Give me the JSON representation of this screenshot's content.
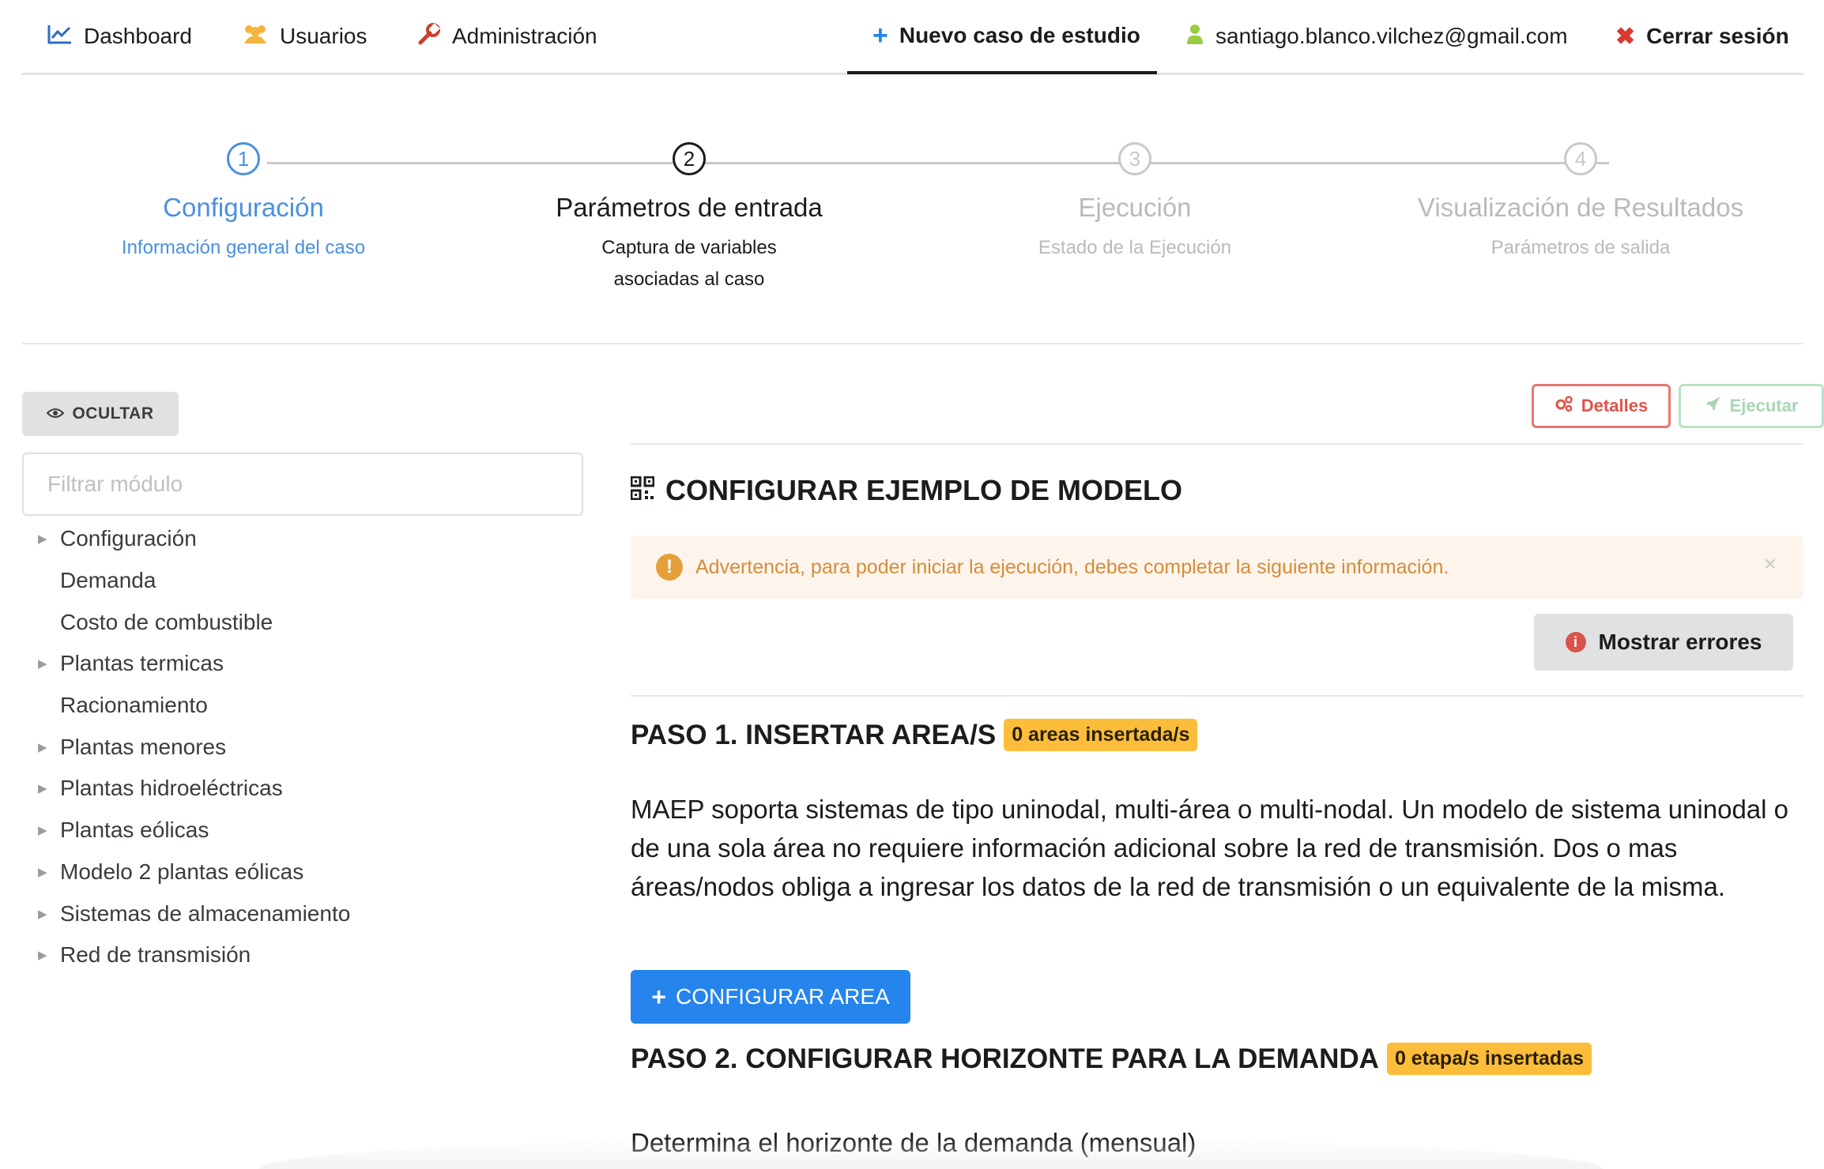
{
  "nav": {
    "dashboard": "Dashboard",
    "users": "Usuarios",
    "admin": "Administración",
    "new_case": "Nuevo caso de estudio",
    "email": "santiago.blanco.vilchez@gmail.com",
    "logout": "Cerrar sesión"
  },
  "steps": [
    {
      "number": "1",
      "title": "Configuración",
      "desc1": "Información general del caso",
      "desc2": "",
      "state": "done"
    },
    {
      "number": "2",
      "title": "Parámetros de entrada",
      "desc1": "Captura de variables",
      "desc2": "asociadas al caso",
      "state": "current"
    },
    {
      "number": "3",
      "title": "Ejecución",
      "desc1": "Estado de la Ejecución",
      "desc2": "",
      "state": "future"
    },
    {
      "number": "4",
      "title": "Visualización de Resultados",
      "desc1": "Parámetros de salida",
      "desc2": "",
      "state": "future"
    }
  ],
  "sidebar": {
    "hide_label": "OCULTAR",
    "filter_placeholder": "Filtrar módulo",
    "items": [
      {
        "label": "Configuración",
        "expandable": true
      },
      {
        "label": "Demanda",
        "expandable": false
      },
      {
        "label": "Costo de combustible",
        "expandable": false
      },
      {
        "label": "Plantas termicas",
        "expandable": true
      },
      {
        "label": "Racionamiento",
        "expandable": false
      },
      {
        "label": "Plantas menores",
        "expandable": true
      },
      {
        "label": "Plantas hidroeléctricas",
        "expandable": true
      },
      {
        "label": "Plantas eólicas",
        "expandable": true
      },
      {
        "label": "Modelo 2 plantas eólicas",
        "expandable": true
      },
      {
        "label": "Sistemas de almacenamiento",
        "expandable": true
      },
      {
        "label": "Red de transmisión",
        "expandable": true
      }
    ]
  },
  "main": {
    "details_button": "Detalles",
    "execute_button": "Ejecutar",
    "section_title": "CONFIGURAR EJEMPLO DE MODELO",
    "warning": "Advertencia, para poder iniciar la ejecución, debes completar la siguiente información.",
    "show_errors": "Mostrar errores",
    "paso1_title": "PASO 1. INSERTAR AREA/S",
    "paso1_badge": "0 areas insertada/s",
    "paso1_text": "MAEP soporta sistemas de tipo uninodal, multi-área o multi-nodal. Un modelo de sistema uninodal o de una sola área no requiere información adicional sobre la red de transmisión. Dos o mas áreas/nodos obliga a ingresar los datos de la red de transmisión o un equivalente de la misma.",
    "configure_area_button": "CONFIGURAR AREA",
    "paso2_title": "PASO 2. CONFIGURAR HORIZONTE PARA LA DEMANDA",
    "paso2_badge": "0 etapa/s insertadas",
    "paso2_text": "Determina el horizonte de la demanda (mensual)"
  },
  "colors": {
    "primary": "#2585ec",
    "step_done": "#4a90e2",
    "badge": "#fbbd3a",
    "warning_bg": "#fdf5ec",
    "warning_text": "#d68c3b",
    "danger": "#e0524a",
    "success_light": "#a8d6b3"
  }
}
